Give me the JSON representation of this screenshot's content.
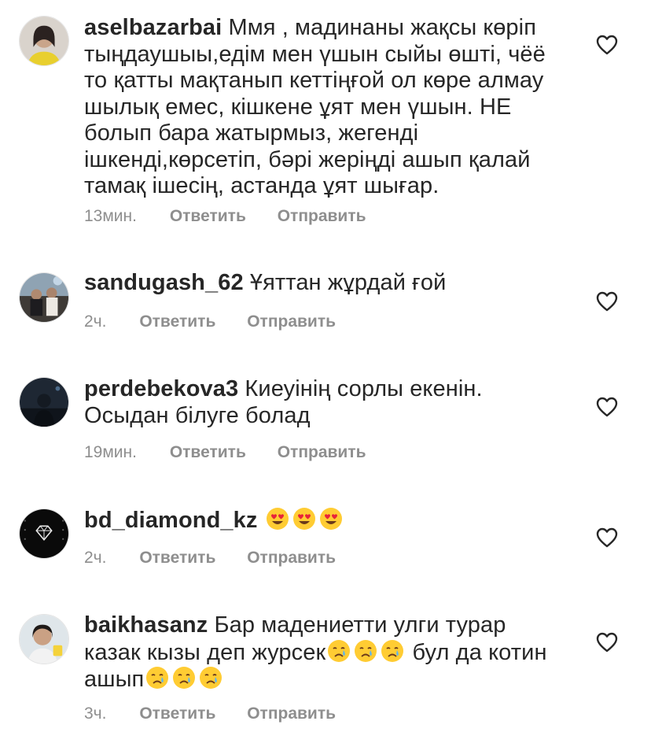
{
  "comments": [
    {
      "username": "aselbazarbai",
      "text": "Ммя , мадинаны жақсы көріп тыңдаушыы,едім мен үшын сыйы өшті, чёё то қатты мақтанып кеттіңғой ол көре алмау шылық емес, кішкене ұят мен үшын. НЕ болып бара жатырмыз, жегенді ішкенді,көрсетіп, бәрі жеріңді ашып қалай тамақ ішесің, астанда ұят шығар.",
      "time": "13мин.",
      "reply": "Ответить",
      "send": "Отправить"
    },
    {
      "username": "sandugash_62",
      "text": "Ұяттан жұрдай ғой",
      "time": "2ч.",
      "reply": "Ответить",
      "send": "Отправить"
    },
    {
      "username": "perdebekova3",
      "text": "Киеуінің сорлы екенін. Осыдан білуге болад",
      "time": "19мин.",
      "reply": "Ответить",
      "send": "Отправить"
    },
    {
      "username": "bd_diamond_kz",
      "emojis": [
        "heart-eyes-emoji",
        "heart-eyes-emoji",
        "heart-eyes-emoji"
      ],
      "time": "2ч.",
      "reply": "Ответить",
      "send": "Отправить"
    },
    {
      "username": "baikhasanz",
      "text_part1": "Бар мадениетти улги турар казак кызы деп журсек",
      "emojis_part1": [
        "crying-face-emoji",
        "crying-face-emoji",
        "crying-face-emoji"
      ],
      "text_part2": "бул да котин ашып",
      "emojis_part2": [
        "crying-face-emoji",
        "crying-face-emoji",
        "crying-face-emoji"
      ],
      "time": "3ч.",
      "reply": "Ответить",
      "send": "Отправить"
    }
  ],
  "icons": {
    "like": "heart-outline-icon"
  },
  "colors": {
    "text": "#262626",
    "meta": "#8e8e8e",
    "background": "#ffffff"
  }
}
